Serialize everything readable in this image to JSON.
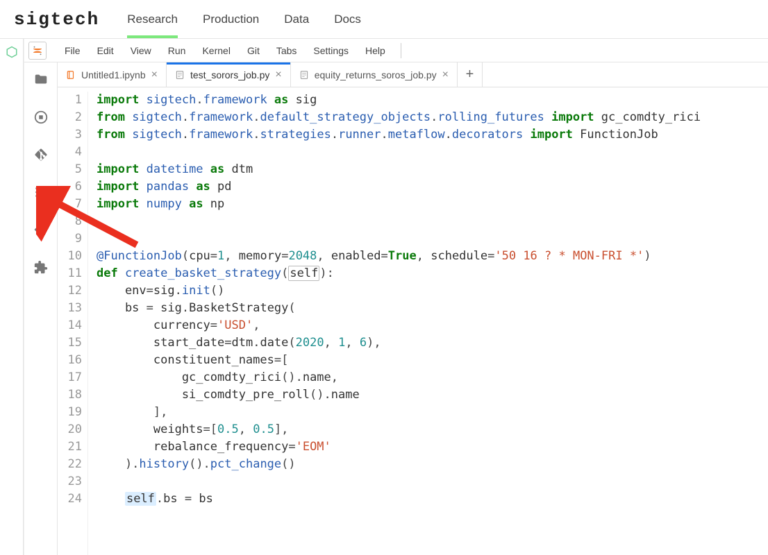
{
  "brand": "sigtech",
  "top_nav": {
    "items": [
      "Research",
      "Production",
      "Data",
      "Docs"
    ],
    "active_index": 0
  },
  "menu_bar": {
    "items": [
      "File",
      "Edit",
      "View",
      "Run",
      "Kernel",
      "Git",
      "Tabs",
      "Settings",
      "Help"
    ]
  },
  "activity_bar": {
    "icons": [
      "folder-icon",
      "running-icon",
      "git-icon",
      "toc-icon",
      "code-icon",
      "extensions-icon"
    ]
  },
  "tabs": {
    "items": [
      {
        "label": "Untitled1.ipynb",
        "icon": "notebook-icon",
        "active": false,
        "closable": true
      },
      {
        "label": "test_sorors_job.py",
        "icon": "python-icon",
        "active": true,
        "closable": true
      },
      {
        "label": "equity_returns_soros_job.py",
        "icon": "python-icon",
        "active": false,
        "closable": true
      }
    ]
  },
  "editor": {
    "line_count": 24,
    "lines": [
      [
        {
          "t": "import ",
          "c": "kw"
        },
        {
          "t": "sigtech",
          "c": "mod"
        },
        {
          "t": ".",
          "c": "op"
        },
        {
          "t": "framework",
          "c": "mod"
        },
        {
          "t": " as ",
          "c": "kw"
        },
        {
          "t": "sig",
          "c": ""
        }
      ],
      [
        {
          "t": "from ",
          "c": "kw"
        },
        {
          "t": "sigtech",
          "c": "mod"
        },
        {
          "t": ".",
          "c": "op"
        },
        {
          "t": "framework",
          "c": "mod"
        },
        {
          "t": ".",
          "c": "op"
        },
        {
          "t": "default_strategy_objects",
          "c": "mod"
        },
        {
          "t": ".",
          "c": "op"
        },
        {
          "t": "rolling_futures",
          "c": "mod"
        },
        {
          "t": " import ",
          "c": "kw"
        },
        {
          "t": "gc_comdty_rici",
          "c": ""
        }
      ],
      [
        {
          "t": "from ",
          "c": "kw"
        },
        {
          "t": "sigtech",
          "c": "mod"
        },
        {
          "t": ".",
          "c": "op"
        },
        {
          "t": "framework",
          "c": "mod"
        },
        {
          "t": ".",
          "c": "op"
        },
        {
          "t": "strategies",
          "c": "mod"
        },
        {
          "t": ".",
          "c": "op"
        },
        {
          "t": "runner",
          "c": "mod"
        },
        {
          "t": ".",
          "c": "op"
        },
        {
          "t": "metaflow",
          "c": "mod"
        },
        {
          "t": ".",
          "c": "op"
        },
        {
          "t": "decorators",
          "c": "mod"
        },
        {
          "t": " import ",
          "c": "kw"
        },
        {
          "t": "FunctionJob",
          "c": ""
        }
      ],
      [],
      [
        {
          "t": "import ",
          "c": "kw"
        },
        {
          "t": "datetime",
          "c": "mod"
        },
        {
          "t": " as ",
          "c": "kw"
        },
        {
          "t": "dtm",
          "c": ""
        }
      ],
      [
        {
          "t": "import ",
          "c": "kw"
        },
        {
          "t": "pandas",
          "c": "mod"
        },
        {
          "t": " as ",
          "c": "kw"
        },
        {
          "t": "pd",
          "c": ""
        }
      ],
      [
        {
          "t": "import ",
          "c": "kw"
        },
        {
          "t": "numpy",
          "c": "mod"
        },
        {
          "t": " as ",
          "c": "kw"
        },
        {
          "t": "np",
          "c": ""
        }
      ],
      [],
      [],
      [
        {
          "t": "@FunctionJob",
          "c": "dec"
        },
        {
          "t": "(",
          "c": "op"
        },
        {
          "t": "cpu",
          "c": ""
        },
        {
          "t": "=",
          "c": "op"
        },
        {
          "t": "1",
          "c": "num"
        },
        {
          "t": ", ",
          "c": "op"
        },
        {
          "t": "memory",
          "c": ""
        },
        {
          "t": "=",
          "c": "op"
        },
        {
          "t": "2048",
          "c": "num"
        },
        {
          "t": ", ",
          "c": "op"
        },
        {
          "t": "enabled",
          "c": ""
        },
        {
          "t": "=",
          "c": "op"
        },
        {
          "t": "True",
          "c": "bool"
        },
        {
          "t": ", ",
          "c": "op"
        },
        {
          "t": "schedule",
          "c": ""
        },
        {
          "t": "=",
          "c": "op"
        },
        {
          "t": "'50 16 ? * MON-FRI *'",
          "c": "str"
        },
        {
          "t": ")",
          "c": "op"
        }
      ],
      [
        {
          "t": "def ",
          "c": "kw"
        },
        {
          "t": "create_basket_strategy",
          "c": "fn"
        },
        {
          "t": "(",
          "c": "op"
        },
        {
          "t": "self",
          "c": "cursor-box"
        },
        {
          "t": "):",
          "c": "op"
        }
      ],
      [
        {
          "t": "    env",
          "c": ""
        },
        {
          "t": "=",
          "c": "op"
        },
        {
          "t": "sig",
          "c": ""
        },
        {
          "t": ".",
          "c": "op"
        },
        {
          "t": "init",
          "c": "fn"
        },
        {
          "t": "()",
          "c": "op"
        }
      ],
      [
        {
          "t": "    bs ",
          "c": ""
        },
        {
          "t": "= ",
          "c": "op"
        },
        {
          "t": "sig",
          "c": ""
        },
        {
          "t": ".",
          "c": "op"
        },
        {
          "t": "BasketStrategy",
          "c": ""
        },
        {
          "t": "(",
          "c": "op"
        }
      ],
      [
        {
          "t": "        currency",
          "c": ""
        },
        {
          "t": "=",
          "c": "op"
        },
        {
          "t": "'USD'",
          "c": "str"
        },
        {
          "t": ",",
          "c": "op"
        }
      ],
      [
        {
          "t": "        start_date",
          "c": ""
        },
        {
          "t": "=",
          "c": "op"
        },
        {
          "t": "dtm",
          "c": ""
        },
        {
          "t": ".",
          "c": "op"
        },
        {
          "t": "date",
          "c": ""
        },
        {
          "t": "(",
          "c": "op"
        },
        {
          "t": "2020",
          "c": "num"
        },
        {
          "t": ", ",
          "c": "op"
        },
        {
          "t": "1",
          "c": "num"
        },
        {
          "t": ", ",
          "c": "op"
        },
        {
          "t": "6",
          "c": "num"
        },
        {
          "t": "),",
          "c": "op"
        }
      ],
      [
        {
          "t": "        constituent_names",
          "c": ""
        },
        {
          "t": "=[",
          "c": "op"
        }
      ],
      [
        {
          "t": "            gc_comdty_rici",
          "c": ""
        },
        {
          "t": "().",
          "c": "op"
        },
        {
          "t": "name",
          "c": ""
        },
        {
          "t": ",",
          "c": "op"
        }
      ],
      [
        {
          "t": "            si_comdty_pre_roll",
          "c": ""
        },
        {
          "t": "().",
          "c": "op"
        },
        {
          "t": "name",
          "c": ""
        }
      ],
      [
        {
          "t": "        ],",
          "c": "op"
        }
      ],
      [
        {
          "t": "        weights",
          "c": ""
        },
        {
          "t": "=[",
          "c": "op"
        },
        {
          "t": "0.5",
          "c": "num"
        },
        {
          "t": ", ",
          "c": "op"
        },
        {
          "t": "0.5",
          "c": "num"
        },
        {
          "t": "],",
          "c": "op"
        }
      ],
      [
        {
          "t": "        rebalance_frequency",
          "c": ""
        },
        {
          "t": "=",
          "c": "op"
        },
        {
          "t": "'EOM'",
          "c": "str"
        }
      ],
      [
        {
          "t": "    ).",
          "c": "op"
        },
        {
          "t": "history",
          "c": "fn"
        },
        {
          "t": "().",
          "c": "op"
        },
        {
          "t": "pct_change",
          "c": "fn"
        },
        {
          "t": "()",
          "c": "op"
        }
      ],
      [],
      [
        {
          "t": "    ",
          "c": ""
        },
        {
          "t": "self",
          "c": "self"
        },
        {
          "t": ".",
          "c": "op"
        },
        {
          "t": "bs ",
          "c": ""
        },
        {
          "t": "= ",
          "c": "op"
        },
        {
          "t": "bs",
          "c": ""
        }
      ]
    ]
  },
  "annotation": {
    "arrow_target": "git-icon",
    "color": "#ea2f1f"
  }
}
